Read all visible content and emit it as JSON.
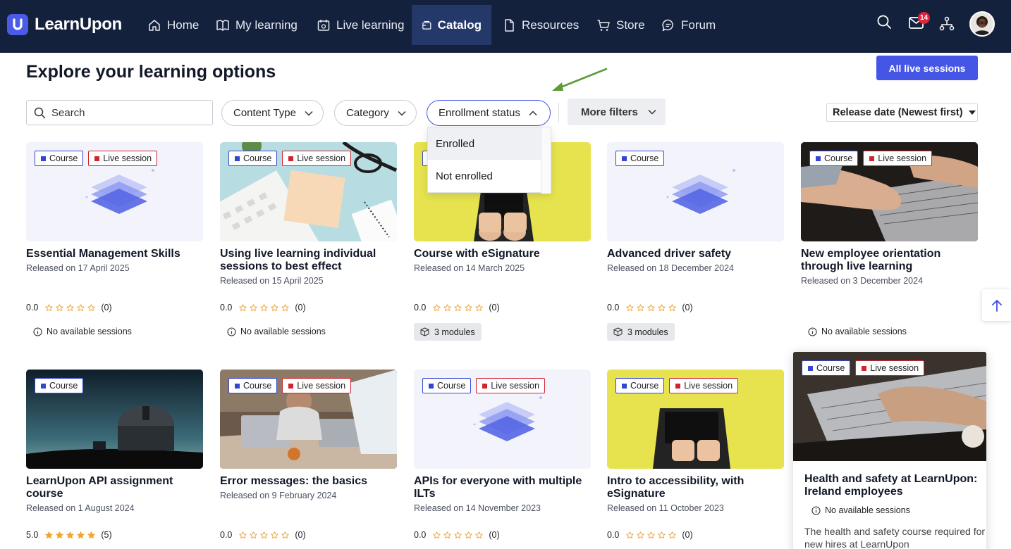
{
  "brand": {
    "name": "LearnUpon"
  },
  "nav": {
    "items": [
      {
        "label": "Home",
        "icon": "home-icon"
      },
      {
        "label": "My learning",
        "icon": "book-icon"
      },
      {
        "label": "Live learning",
        "icon": "calendar-icon"
      },
      {
        "label": "Catalog",
        "icon": "catalog-icon",
        "active": true
      },
      {
        "label": "Resources",
        "icon": "document-icon"
      },
      {
        "label": "Store",
        "icon": "cart-icon"
      },
      {
        "label": "Forum",
        "icon": "chat-icon"
      }
    ],
    "notification_count": "14"
  },
  "page": {
    "title": "Explore your learning options",
    "primary_button": "All live sessions"
  },
  "filters": {
    "search_placeholder": "Search",
    "content_type": "Content Type",
    "category": "Category",
    "enrollment_status": "Enrollment status",
    "more_filters": "More filters",
    "sort": "Release date (Newest first)",
    "enrollment_options": [
      "Enrolled",
      "Not enrolled"
    ]
  },
  "tags": {
    "course": "Course",
    "live": "Live session"
  },
  "cards": [
    {
      "title": "Essential Management Skills",
      "date": "Released on 17 April 2025",
      "rating": "0.0",
      "count": "(0)",
      "info": "No available sessions"
    },
    {
      "title": "Using live learning individual sessions to best effect",
      "date": "Released on 15 April 2025",
      "rating": "0.0",
      "count": "(0)",
      "info": "No available sessions"
    },
    {
      "title": "Course with eSignature",
      "date": "Released on 14 March 2025",
      "rating": "0.0",
      "count": "(0)",
      "info": "3 modules"
    },
    {
      "title": "Advanced driver safety",
      "date": "Released on 18 December 2024",
      "rating": "0.0",
      "count": "(0)",
      "info": "3 modules"
    },
    {
      "title": "New employee orientation through live learning",
      "date": "Released on 3 December 2024",
      "info": "No available sessions"
    },
    {
      "title": "LearnUpon API assignment course",
      "date": "Released on 1 August 2024",
      "rating": "5.0",
      "count": "(5)"
    },
    {
      "title": "Error messages: the basics",
      "date": "Released on 9 February 2024",
      "rating": "0.0",
      "count": "(0)"
    },
    {
      "title": "APIs for everyone with multiple ILTs",
      "date": "Released on 14 November 2023",
      "rating": "0.0",
      "count": "(0)"
    },
    {
      "title": "Intro to accessibility, with eSignature",
      "date": "Released on 11 October 2023",
      "rating": "0.0",
      "count": "(0)"
    }
  ],
  "featured": {
    "title": "Health and safety at LearnUpon: Ireland employees",
    "info": "No available sessions",
    "description": "The health and safety course required for new hires at LearnUpon"
  },
  "colors": {
    "nav_bg": "#14213d",
    "accent": "#4555e6",
    "live_red": "#d0242f"
  }
}
